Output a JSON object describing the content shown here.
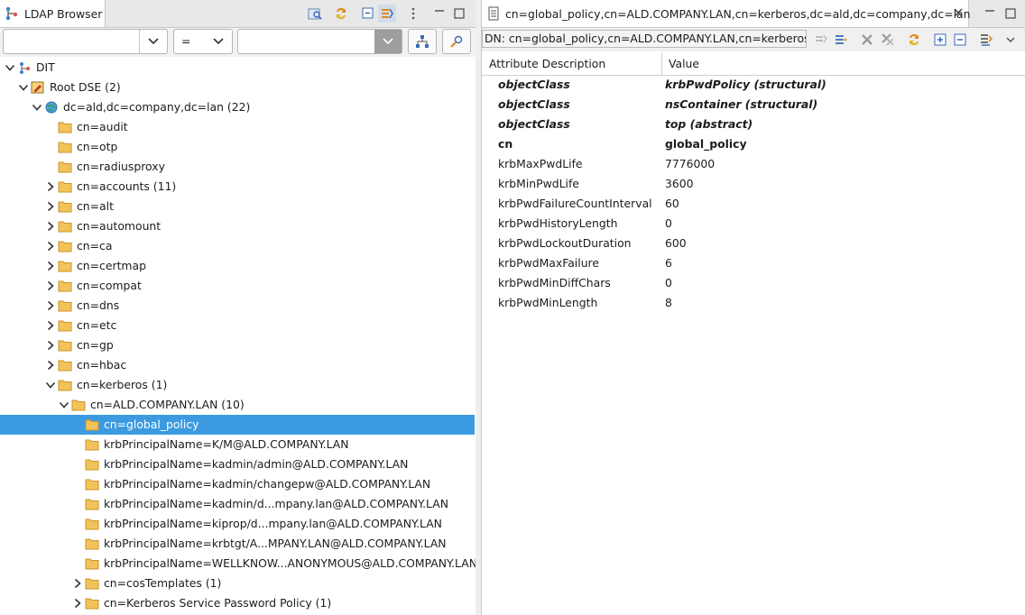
{
  "left_view": {
    "tab_title": "LDAP Browser",
    "filter": {
      "attribute_value": "",
      "operator": "=",
      "value": ""
    },
    "tree": [
      {
        "label": "DIT",
        "depth": 0,
        "state": "open",
        "icon": "dit-icon"
      },
      {
        "label": "Root DSE (2)",
        "depth": 1,
        "state": "open",
        "icon": "root-dse-icon"
      },
      {
        "label": "dc=ald,dc=company,dc=lan (22)",
        "depth": 2,
        "state": "open",
        "icon": "globe-icon"
      },
      {
        "label": "cn=audit",
        "depth": 3,
        "state": "none",
        "icon": "folder-icon"
      },
      {
        "label": "cn=otp",
        "depth": 3,
        "state": "none",
        "icon": "folder-icon"
      },
      {
        "label": "cn=radiusproxy",
        "depth": 3,
        "state": "none",
        "icon": "folder-icon"
      },
      {
        "label": "cn=accounts (11)",
        "depth": 3,
        "state": "closed",
        "icon": "folder-icon"
      },
      {
        "label": "cn=alt",
        "depth": 3,
        "state": "closed",
        "icon": "folder-icon"
      },
      {
        "label": "cn=automount",
        "depth": 3,
        "state": "closed",
        "icon": "folder-icon"
      },
      {
        "label": "cn=ca",
        "depth": 3,
        "state": "closed",
        "icon": "folder-icon"
      },
      {
        "label": "cn=certmap",
        "depth": 3,
        "state": "closed",
        "icon": "folder-icon"
      },
      {
        "label": "cn=compat",
        "depth": 3,
        "state": "closed",
        "icon": "folder-icon"
      },
      {
        "label": "cn=dns",
        "depth": 3,
        "state": "closed",
        "icon": "folder-icon"
      },
      {
        "label": "cn=etc",
        "depth": 3,
        "state": "closed",
        "icon": "folder-icon"
      },
      {
        "label": "cn=gp",
        "depth": 3,
        "state": "closed",
        "icon": "folder-icon"
      },
      {
        "label": "cn=hbac",
        "depth": 3,
        "state": "closed",
        "icon": "folder-icon"
      },
      {
        "label": "cn=kerberos (1)",
        "depth": 3,
        "state": "open",
        "icon": "folder-icon"
      },
      {
        "label": "cn=ALD.COMPANY.LAN (10)",
        "depth": 4,
        "state": "open",
        "icon": "folder-icon"
      },
      {
        "label": "cn=global_policy",
        "depth": 5,
        "state": "none",
        "icon": "folder-icon",
        "selected": true
      },
      {
        "label": "krbPrincipalName=K/M@ALD.COMPANY.LAN",
        "depth": 5,
        "state": "none",
        "icon": "folder-icon"
      },
      {
        "label": "krbPrincipalName=kadmin/admin@ALD.COMPANY.LAN",
        "depth": 5,
        "state": "none",
        "icon": "folder-icon"
      },
      {
        "label": "krbPrincipalName=kadmin/changepw@ALD.COMPANY.LAN",
        "depth": 5,
        "state": "none",
        "icon": "folder-icon"
      },
      {
        "label": "krbPrincipalName=kadmin/d...mpany.lan@ALD.COMPANY.LAN",
        "depth": 5,
        "state": "none",
        "icon": "folder-icon"
      },
      {
        "label": "krbPrincipalName=kiprop/d...mpany.lan@ALD.COMPANY.LAN",
        "depth": 5,
        "state": "none",
        "icon": "folder-icon"
      },
      {
        "label": "krbPrincipalName=krbtgt/A...MPANY.LAN@ALD.COMPANY.LAN",
        "depth": 5,
        "state": "none",
        "icon": "folder-icon"
      },
      {
        "label": "krbPrincipalName=WELLKNOW...ANONYMOUS@ALD.COMPANY.LAN",
        "depth": 5,
        "state": "none",
        "icon": "folder-icon"
      },
      {
        "label": "cn=cosTemplates (1)",
        "depth": 5,
        "state": "closed",
        "icon": "folder-icon"
      },
      {
        "label": "cn=Kerberos Service Password Policy (1)",
        "depth": 5,
        "state": "closed",
        "icon": "folder-icon"
      }
    ]
  },
  "editor": {
    "tab_title": "cn=global_policy,cn=ALD.COMPANY.LAN,cn=kerberos,dc=ald,dc=company,dc=lan",
    "dn_text": "DN: cn=global_policy,cn=ALD.COMPANY.LAN,cn=kerberos,dc=ald,dc=company,dc=lan",
    "columns": [
      "Attribute Description",
      "Value"
    ],
    "rows": [
      {
        "attr": "objectClass",
        "value": "krbPwdPolicy (structural)",
        "style": "bold-italic"
      },
      {
        "attr": "objectClass",
        "value": "nsContainer (structural)",
        "style": "bold-italic"
      },
      {
        "attr": "objectClass",
        "value": "top (abstract)",
        "style": "bold-italic"
      },
      {
        "attr": "cn",
        "value": "global_policy",
        "style": "bold"
      },
      {
        "attr": "krbMaxPwdLife",
        "value": "7776000",
        "style": "normal"
      },
      {
        "attr": "krbMinPwdLife",
        "value": "3600",
        "style": "normal"
      },
      {
        "attr": "krbPwdFailureCountInterval",
        "value": "60",
        "style": "normal"
      },
      {
        "attr": "krbPwdHistoryLength",
        "value": "0",
        "style": "normal"
      },
      {
        "attr": "krbPwdLockoutDuration",
        "value": "600",
        "style": "normal"
      },
      {
        "attr": "krbPwdMaxFailure",
        "value": "6",
        "style": "normal"
      },
      {
        "attr": "krbPwdMinDiffChars",
        "value": "0",
        "style": "normal"
      },
      {
        "attr": "krbPwdMinLength",
        "value": "8",
        "style": "normal"
      }
    ]
  },
  "colors": {
    "selection": "#3c9be0",
    "folder": "#f2c35a",
    "folder_edge": "#c9962b",
    "accent_blue": "#2f6fc4",
    "arrow_orange": "#e08a1c"
  }
}
